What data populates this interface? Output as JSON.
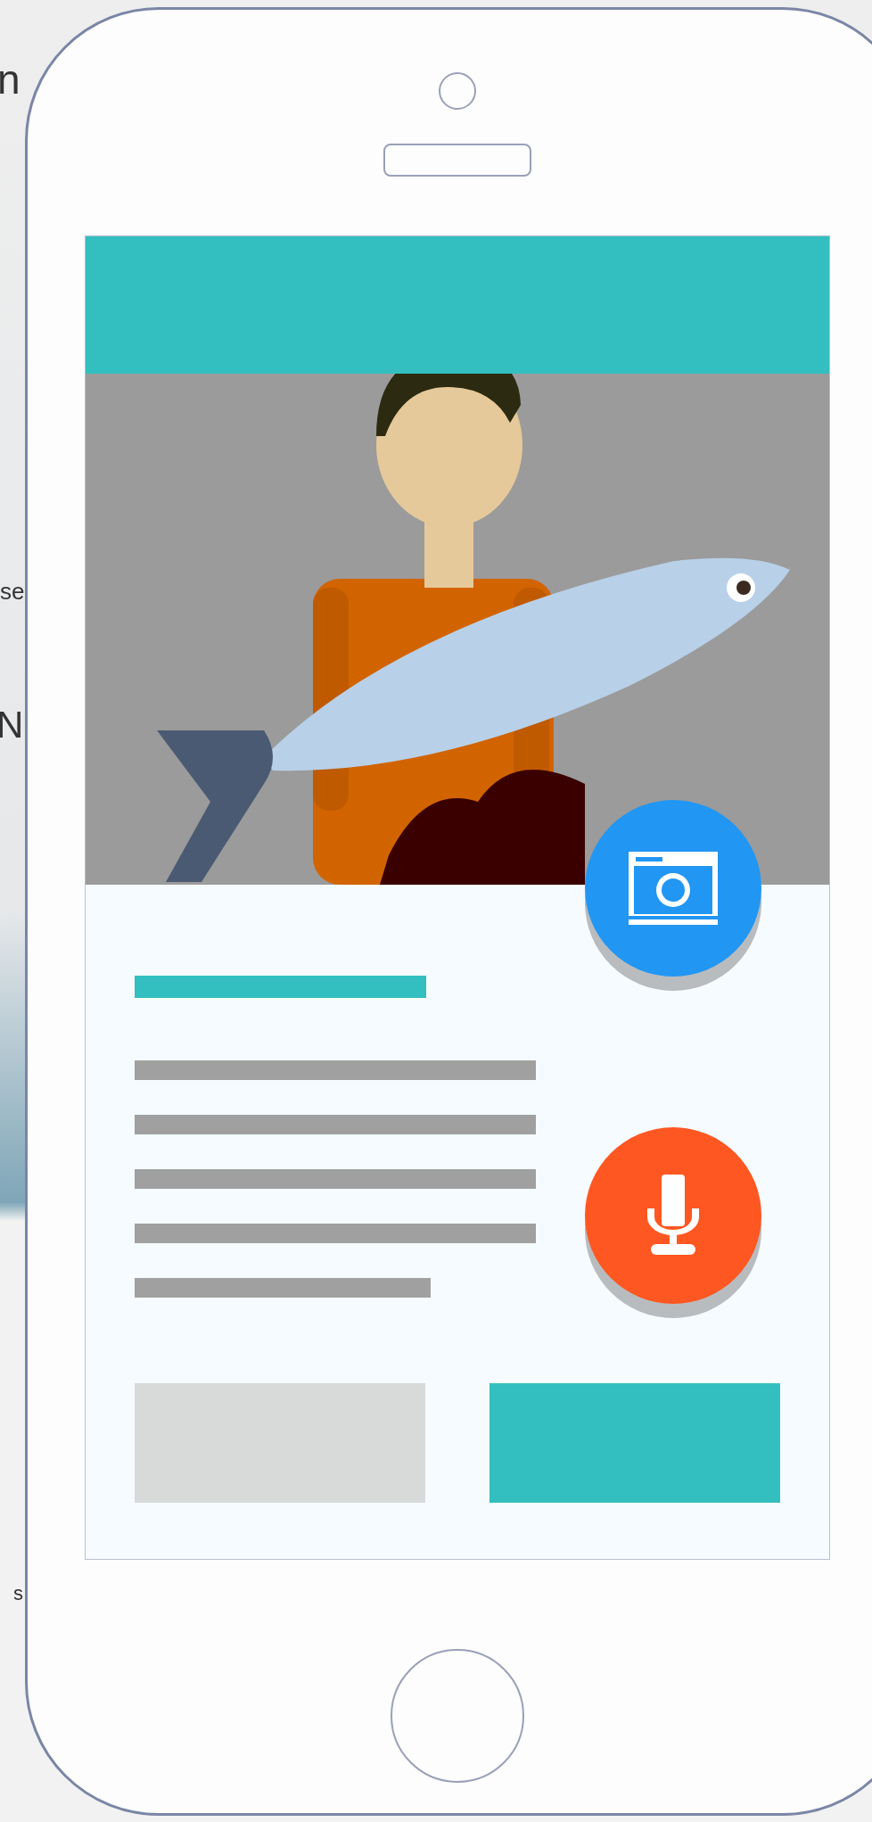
{
  "background_fragments": [
    "n",
    "se",
    "N",
    "s"
  ],
  "fabs": [
    {
      "kind": "camera"
    },
    {
      "kind": "microphone"
    }
  ],
  "buttons": [
    {
      "kind": "secondary"
    },
    {
      "kind": "primary"
    }
  ]
}
